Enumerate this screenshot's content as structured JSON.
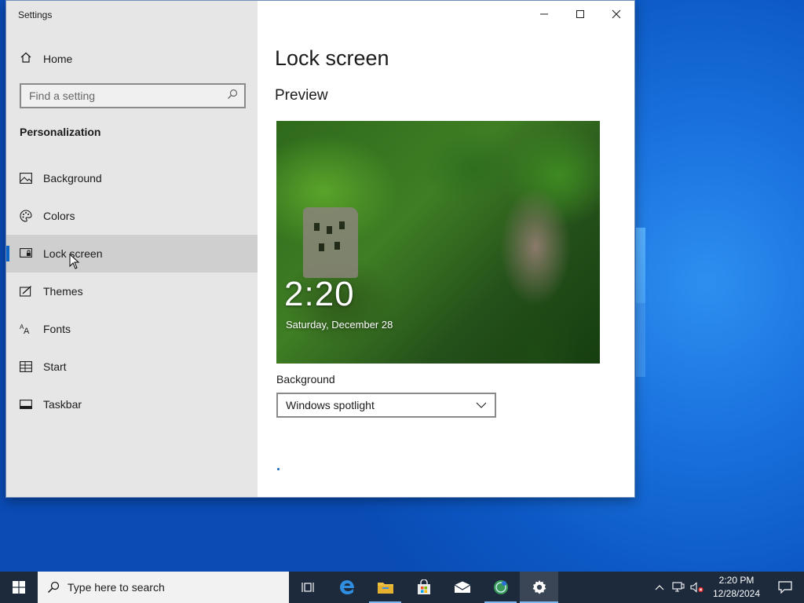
{
  "window": {
    "app_title": "Settings"
  },
  "sidebar": {
    "home_label": "Home",
    "search_placeholder": "Find a setting",
    "section_header": "Personalization",
    "items": [
      {
        "label": "Background",
        "icon": "image-icon"
      },
      {
        "label": "Colors",
        "icon": "palette-icon"
      },
      {
        "label": "Lock screen",
        "icon": "lock-screen-icon",
        "active": true
      },
      {
        "label": "Themes",
        "icon": "themes-icon"
      },
      {
        "label": "Fonts",
        "icon": "fonts-icon"
      },
      {
        "label": "Start",
        "icon": "start-icon"
      },
      {
        "label": "Taskbar",
        "icon": "taskbar-icon"
      }
    ]
  },
  "main": {
    "page_title": "Lock screen",
    "preview_heading": "Preview",
    "lock_time": "2:20",
    "lock_date": "Saturday, December 28",
    "background_label": "Background",
    "background_value": "Windows spotlight"
  },
  "taskbar": {
    "search_placeholder": "Type here to search",
    "clock_time": "2:20 PM",
    "clock_date": "12/28/2024"
  },
  "colors": {
    "accent": "#0a64c8",
    "taskbar": "#1c2a3c",
    "sidebar": "#e6e6e6"
  }
}
